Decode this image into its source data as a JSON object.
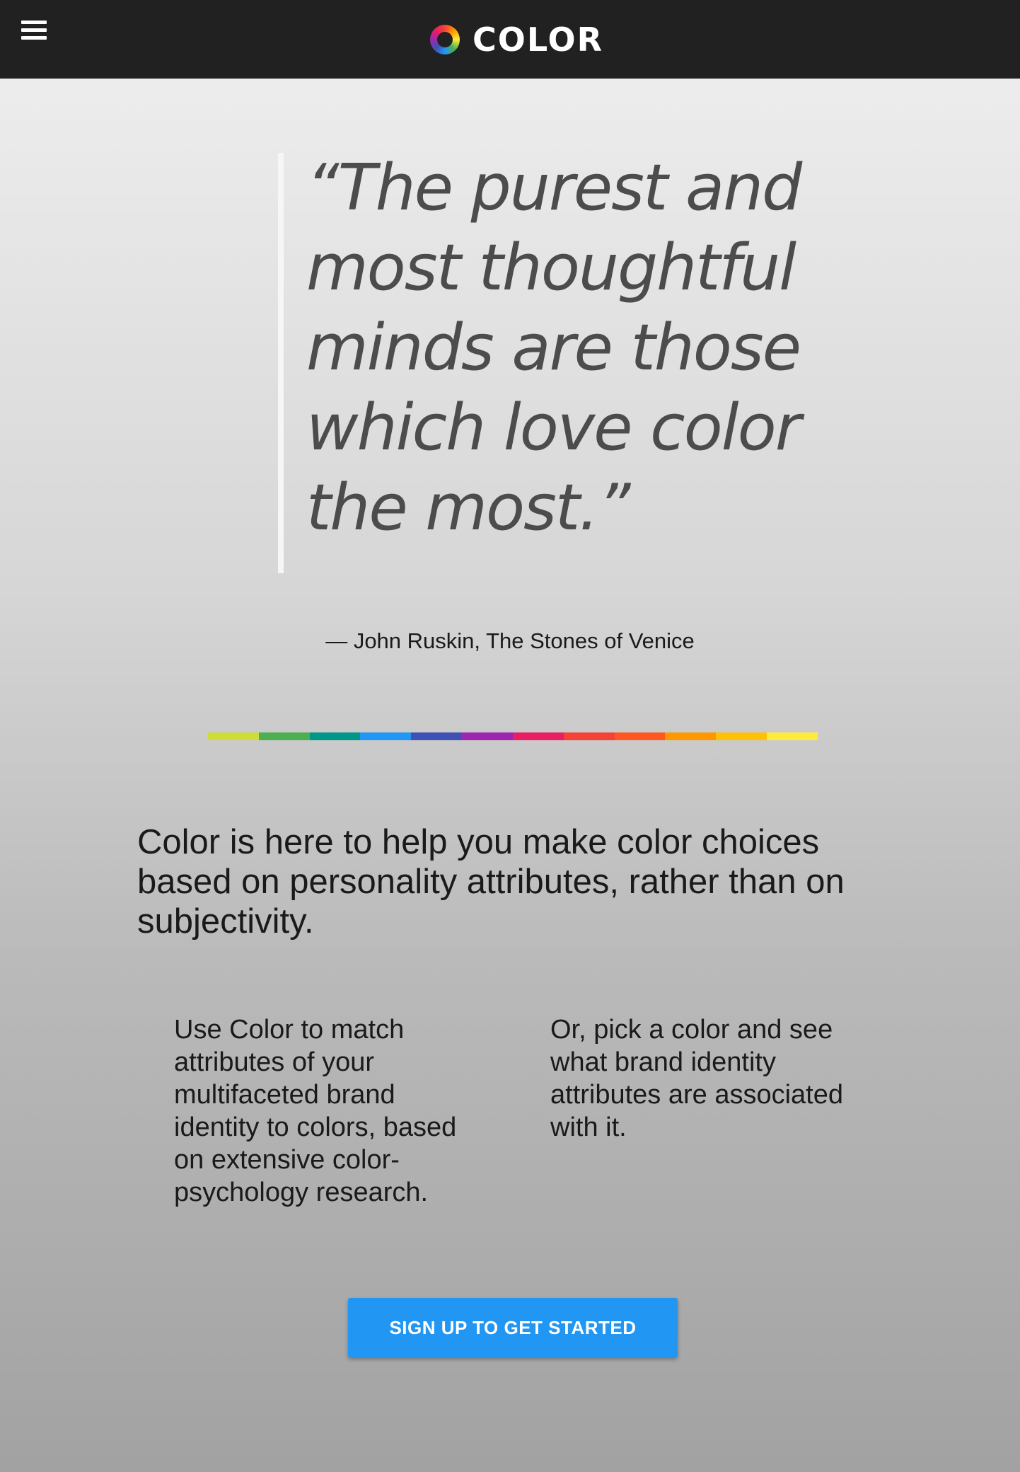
{
  "header": {
    "brand_title": "COLOR",
    "menu_icon": "hamburger-menu-icon",
    "logo_icon": "color-wheel-logo-icon",
    "background_color": "#212121"
  },
  "quote": {
    "text": "“The purest and\nmost thoughtful\nminds are those\nwhich love color\nthe most.”",
    "attribution": "— John Ruskin, The Stones of Venice"
  },
  "spectrum": {
    "colors": [
      "#cddc39",
      "#4caf50",
      "#009688",
      "#2196f3",
      "#3f51b5",
      "#9c27b0",
      "#e91e63",
      "#f44336",
      "#ff5722",
      "#ff9800",
      "#ffc107",
      "#ffeb3b"
    ]
  },
  "intro": {
    "text": "Color is here to help you make color choices based on personality attributes, rather than on subjectivity."
  },
  "columns": {
    "left": "Use Color to match attributes of your multifaceted brand identity to colors, based on extensive color-psychology research.",
    "right": "Or, pick a color and see what brand identity attributes are associated with it."
  },
  "cta": {
    "label": "SIGN UP TO GET STARTED",
    "color": "#2196f3"
  }
}
